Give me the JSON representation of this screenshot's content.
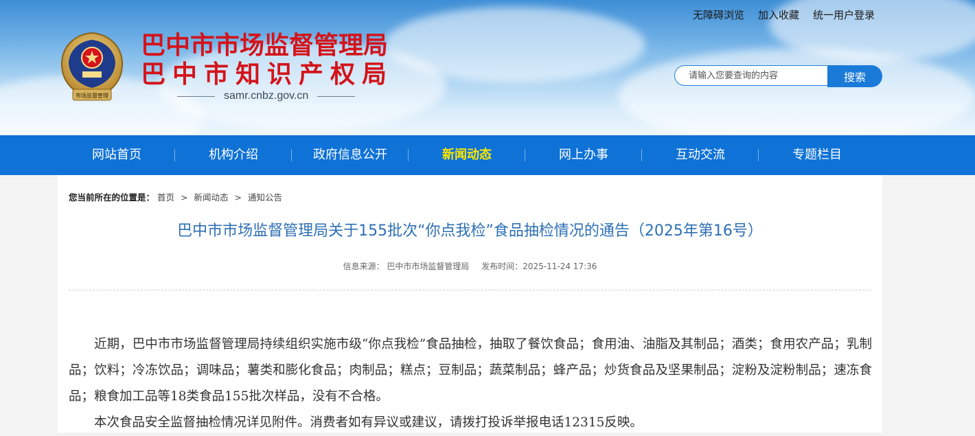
{
  "header": {
    "org_name_1": "巴中市市场监督管理局",
    "org_name_2": "巴中市知识产权局",
    "domain": "samr.cnbz.gov.cn",
    "top_links": [
      "无障碍浏览",
      "加入收藏",
      "统一用户登录"
    ],
    "search": {
      "placeholder": "请输入您要查询的内容",
      "button_label": "搜索"
    },
    "emblem_icon": "national-emblem-icon",
    "emblem_caption": "市场监督管理"
  },
  "nav": {
    "items": [
      {
        "label": "网站首页"
      },
      {
        "label": "机构介绍"
      },
      {
        "label": "政府信息公开"
      },
      {
        "label": "新闻动态",
        "active": true
      },
      {
        "label": "网上办事"
      },
      {
        "label": "互动交流"
      },
      {
        "label": "专题栏目"
      }
    ]
  },
  "breadcrumb": {
    "prefix": "您当前所在的位置是：",
    "items": [
      "首页",
      "新闻动态",
      "通知公告"
    ],
    "separator": ">"
  },
  "article": {
    "title": "巴中市市场监督管理局关于155批次“你点我检”食品抽检情况的通告（2025年第16号）",
    "source": "信息来源： 巴中市市场监督管理局",
    "published": "发布时间：2025-11-24 17:36",
    "paragraphs": [
      "近期，巴中市市场监督管理局持续组织实施市级“你点我检”食品抽检，抽取了餐饮食品；食用油、油脂及其制品；酒类；食用农产品；乳制品；饮料；冷冻饮品；调味品；薯类和膨化食品；肉制品；糕点；豆制品；蔬菜制品；蜂产品；炒货食品及坚果制品；淀粉及淀粉制品；速冻食品；粮食加工品等18类食品155批次样品，没有不合格。",
      "本次食品安全监督抽检情况详见附件。消费者如有异议或建议，请拨打投诉举报电话12315反映。"
    ]
  },
  "colors": {
    "nav_bg": "#0f72d6",
    "nav_active": "#ffe600",
    "title_red": "#d4131a",
    "article_title_blue": "#2d6fb5",
    "search_button": "#1a7ad8"
  }
}
